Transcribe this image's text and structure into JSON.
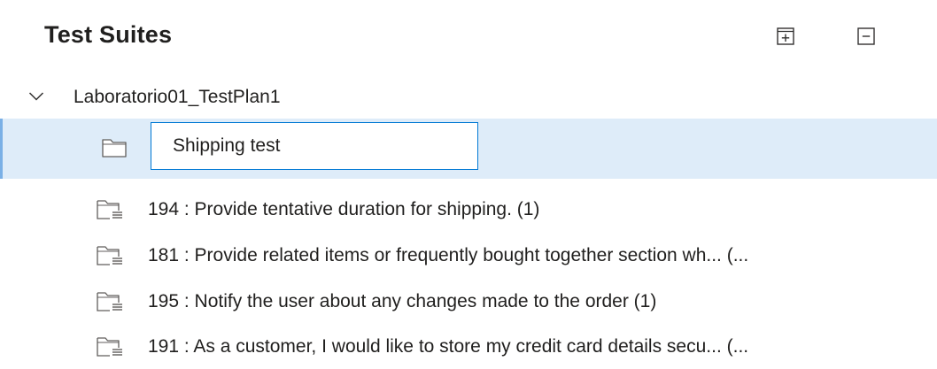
{
  "header": {
    "title": "Test Suites",
    "expand_all_icon": "expand-all-icon",
    "collapse_all_icon": "collapse-all-icon"
  },
  "tree": {
    "root": {
      "label": "Laboratorio01_TestPlan1",
      "expanded": true,
      "icon": "chevron-down-icon"
    },
    "new_suite": {
      "icon": "folder-icon",
      "value": "Shipping test",
      "accent": "#0078d4",
      "row_bg": "#deecf9"
    },
    "suites": [
      {
        "label": "194 : Provide tentative duration for shipping. (1)",
        "icon": "requirement-suite-icon"
      },
      {
        "label": "181 : Provide related items or frequently bought together section wh... (...",
        "icon": "requirement-suite-icon"
      },
      {
        "label": "195 : Notify the user about any changes made to the order (1)",
        "icon": "requirement-suite-icon"
      },
      {
        "label": "191 : As a customer, I would like to store my credit card details secu... (...",
        "icon": "requirement-suite-icon"
      }
    ]
  }
}
